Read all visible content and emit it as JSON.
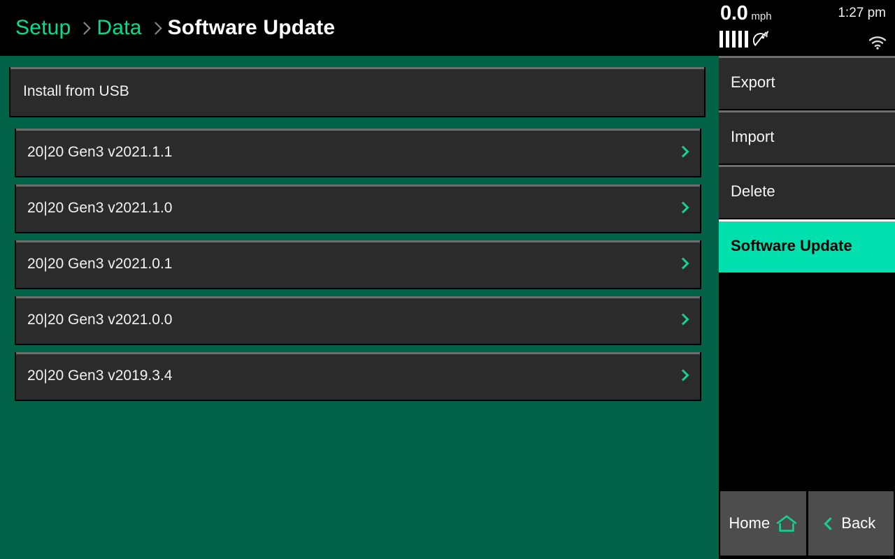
{
  "breadcrumb": {
    "items": [
      {
        "label": "Setup",
        "current": false
      },
      {
        "label": "Data",
        "current": false
      },
      {
        "label": "Software Update",
        "current": true
      }
    ],
    "separator_icon": "chevron-right-icon"
  },
  "status": {
    "speed_value": "0.0",
    "speed_unit": "mph",
    "time": "1:27 pm",
    "gps_bars": 5,
    "gps_icon": "satellite-dish-icon",
    "wifi_icon": "wifi-icon"
  },
  "main": {
    "usb_panel_label": "Install from USB",
    "versions": [
      {
        "label": "20|20 Gen3 v2021.1.1",
        "chevron_icon": "chevron-right-icon"
      },
      {
        "label": "20|20 Gen3 v2021.1.0",
        "chevron_icon": "chevron-right-icon"
      },
      {
        "label": "20|20 Gen3 v2021.0.1",
        "chevron_icon": "chevron-right-icon"
      },
      {
        "label": "20|20 Gen3 v2021.0.0",
        "chevron_icon": "chevron-right-icon"
      },
      {
        "label": "20|20 Gen3 v2019.3.4",
        "chevron_icon": "chevron-right-icon"
      }
    ]
  },
  "sidebar": {
    "items": [
      {
        "label": "Export",
        "active": false
      },
      {
        "label": "Import",
        "active": false
      },
      {
        "label": "Delete",
        "active": false
      },
      {
        "label": "Software Update",
        "active": true
      }
    ],
    "nav": {
      "home_label": "Home",
      "home_icon": "home-icon",
      "back_label": "Back",
      "back_icon": "chevron-left-icon"
    }
  },
  "colors": {
    "background_green": "#006246",
    "accent_mint": "#00dfae",
    "link_green": "#00e08f",
    "panel_dark": "#2b2b2b",
    "panel_top_edge": "#6e6e6e",
    "button_gray": "#4d4d4d"
  }
}
